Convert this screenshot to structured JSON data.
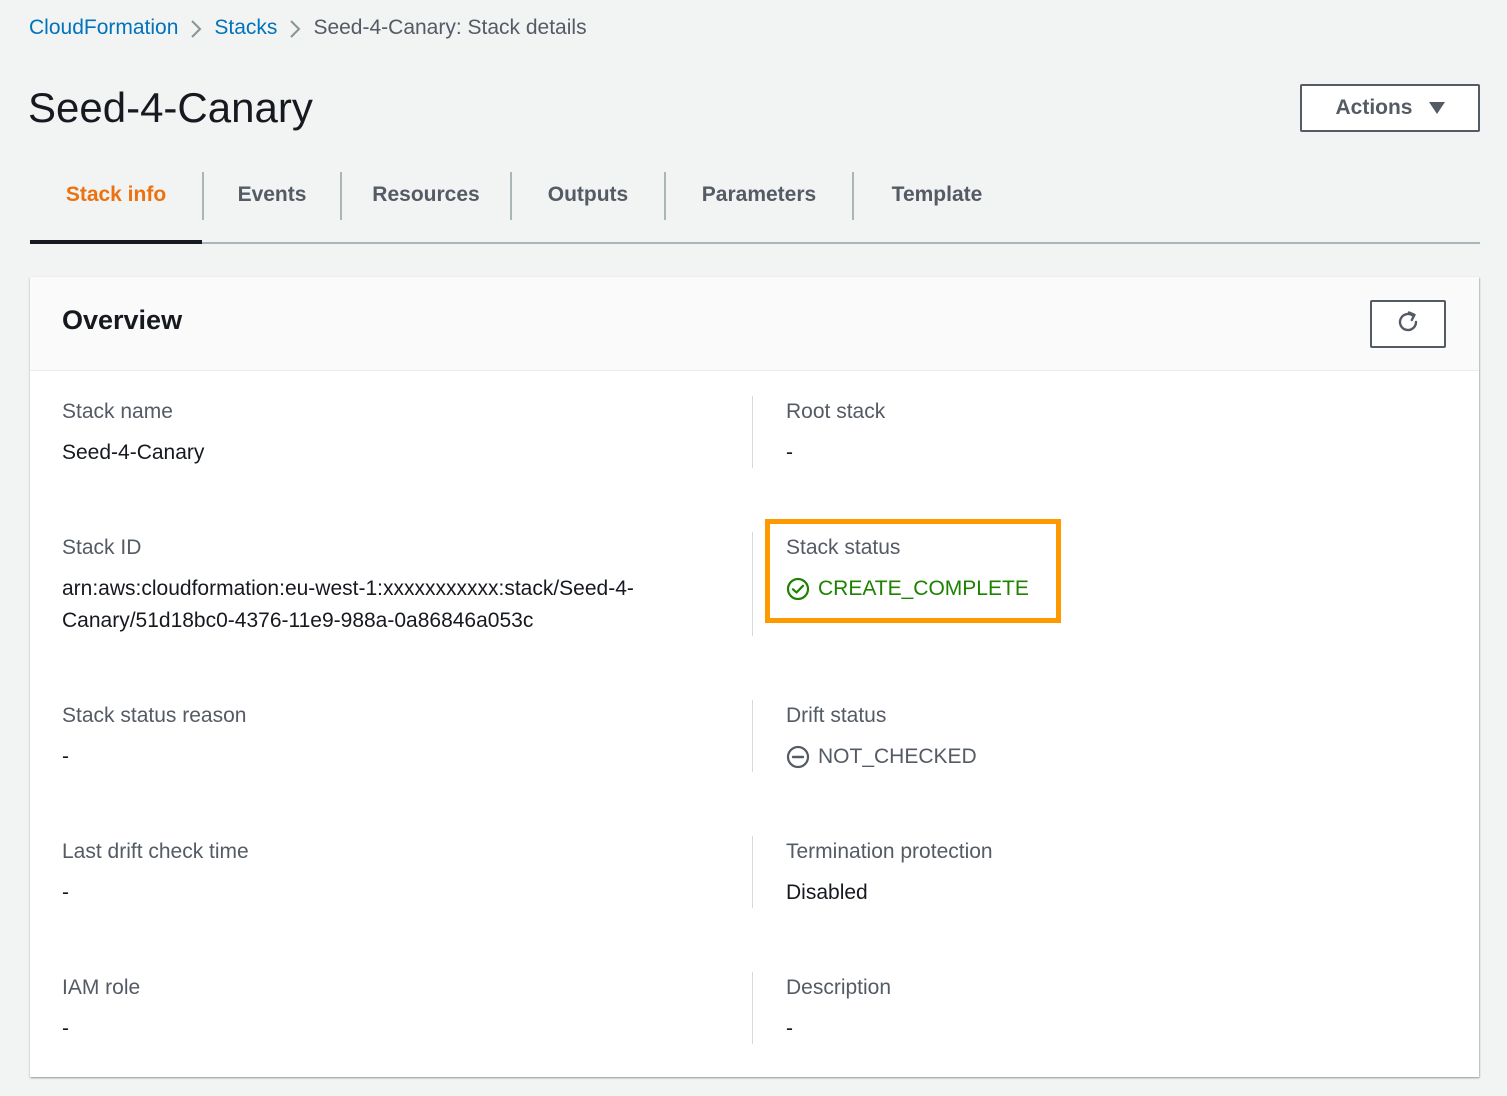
{
  "breadcrumb": {
    "items": [
      "CloudFormation",
      "Stacks"
    ],
    "current": "Seed-4-Canary: Stack details"
  },
  "page": {
    "title": "Seed-4-Canary",
    "actions_label": "Actions"
  },
  "tabs": [
    {
      "label": "Stack info",
      "active": true
    },
    {
      "label": "Events",
      "active": false
    },
    {
      "label": "Resources",
      "active": false
    },
    {
      "label": "Outputs",
      "active": false
    },
    {
      "label": "Parameters",
      "active": false
    },
    {
      "label": "Template",
      "active": false
    }
  ],
  "overview": {
    "title": "Overview",
    "stack_name": {
      "label": "Stack name",
      "value": "Seed-4-Canary"
    },
    "root_stack": {
      "label": "Root stack",
      "value": "-"
    },
    "stack_id": {
      "label": "Stack ID",
      "value_line1": "arn:aws:cloudformation:eu-west-1:xxxxxxxxxxx:stack/Seed-4-",
      "value_line2": "Canary/51d18bc0-4376-11e9-988a-0a86846a053c"
    },
    "stack_status": {
      "label": "Stack status",
      "value": "CREATE_COMPLETE"
    },
    "stack_status_reason": {
      "label": "Stack status reason",
      "value": "-"
    },
    "drift_status": {
      "label": "Drift status",
      "value": "NOT_CHECKED"
    },
    "last_drift_check_time": {
      "label": "Last drift check time",
      "value": "-"
    },
    "termination_protection": {
      "label": "Termination protection",
      "value": "Disabled"
    },
    "iam_role": {
      "label": "IAM role",
      "value": "-"
    },
    "description": {
      "label": "Description",
      "value": "-"
    }
  },
  "colors": {
    "link": "#0073bb",
    "active_tab": "#ec7211",
    "success": "#1d8102",
    "highlight": "#ff9900"
  },
  "icons": {
    "breadcrumb_separator": "chevron-right-icon",
    "actions_caret": "caret-down-icon",
    "refresh": "refresh-icon",
    "status_success": "check-circle-icon",
    "drift_status": "minus-circle-icon"
  }
}
